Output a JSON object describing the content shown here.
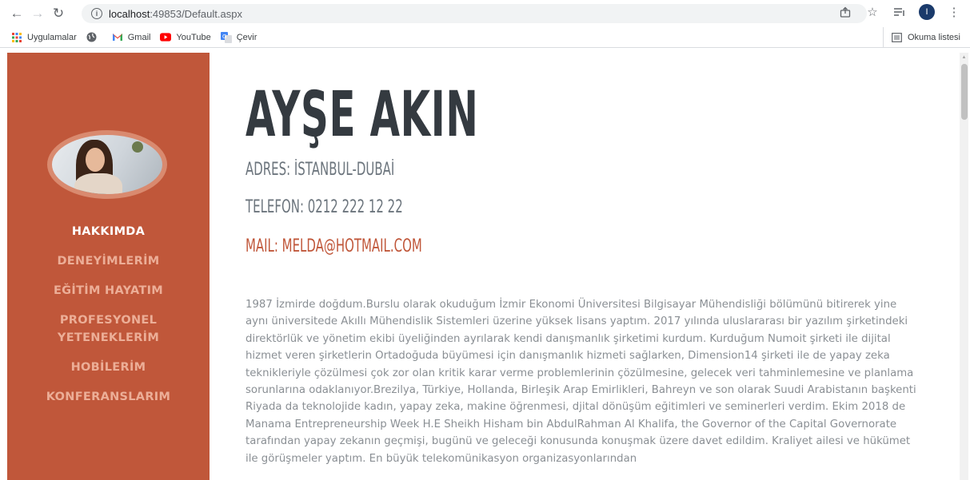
{
  "browser": {
    "url_host": "localhost",
    "url_path": ":49853/Default.aspx",
    "bookmarks": [
      {
        "label": "Uygulamalar",
        "icon": "apps-grid-icon"
      },
      {
        "label": "",
        "icon": "globe-icon"
      },
      {
        "label": "Gmail",
        "icon": "gmail-icon"
      },
      {
        "label": "YouTube",
        "icon": "youtube-icon"
      },
      {
        "label": "Çevir",
        "icon": "translate-icon"
      }
    ],
    "reading_list": "Okuma listesi",
    "profile_initial": "I"
  },
  "sidebar": {
    "background": "#c0573a",
    "menu": [
      {
        "label": "HAKKIMDA",
        "active": true
      },
      {
        "label": "DENEYİMLERİM",
        "active": false
      },
      {
        "label": "EĞİTİM HAYATIM",
        "active": false
      },
      {
        "label": "PROFESYONEL",
        "active": false
      },
      {
        "label": "YETENEKLERİM",
        "active": false
      },
      {
        "label": "HOBİLERİM",
        "active": false
      },
      {
        "label": "KONFERANSLARIM",
        "active": false
      }
    ]
  },
  "main": {
    "name": "AYŞE AKIN",
    "address": "ADRES: İSTANBUL-DUBAİ",
    "phone": "TELEFON: 0212 222 12 22",
    "mail": "MAIL: MELDA@HOTMAIL.COM",
    "bio": "1987 İzmirde doğdum.Burslu olarak okuduğum İzmir Ekonomi Üniversitesi Bilgisayar Mühendisliği bölümünü bitirerek yine aynı üniversitede Akıllı Mühendislik Sistemleri üzerine yüksek lisans yaptım. 2017 yılında uluslararası bir yazılım şirketindeki direktörlük ve yönetim ekibi üyeliğinden ayrılarak kendi danışmanlık şirketimi kurdum. Kurduğum Numoit şirketi ile dijital hizmet veren şirketlerin Ortadoğuda büyümesi için danışmanlık hizmeti sağlarken, Dimension14 şirketi ile de yapay zeka teknikleriyle çözülmesi çok zor olan kritik karar verme problemlerinin çözülmesine, gelecek veri tahminlemesine ve planlama sorunlarına odaklanıyor.Brezilya, Türkiye, Hollanda, Birleşik Arap Emirlikleri, Bahreyn ve son olarak Suudi Arabistanın başkenti Riyada da teknolojide kadın, yapay zeka, makine öğrenmesi, djital dönüşüm eğitimleri ve seminerleri verdim. Ekim 2018 de Manama Entrepreneurship Week H.E Sheikh Hisham bin AbdulRahman Al Khalifa, the Governor of the Capital Governorate tarafından yapay zekanın geçmişi, bugünü ve geleceği konusunda konuşmak üzere davet edildim. Kraliyet ailesi ve hükümet ile görüşmeler yaptım. En büyük telekomünikasyon organizasyonlarından"
  }
}
